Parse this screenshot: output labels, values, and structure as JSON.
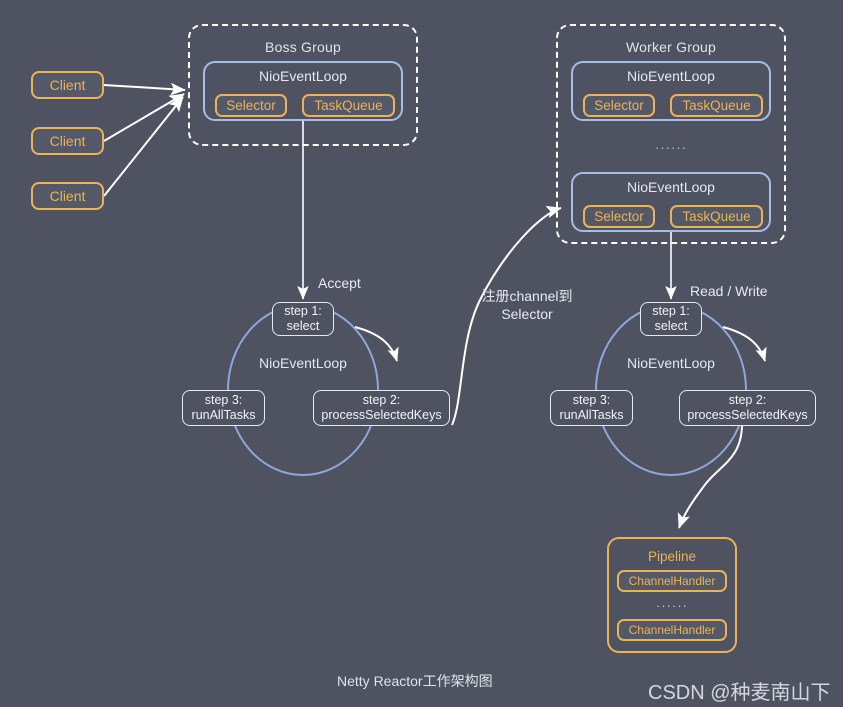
{
  "diagram": {
    "caption": "Netty Reactor工作架构图",
    "watermark": "CSDN @种麦南山下",
    "background_color": "#4e5261",
    "accent_orange": "#e9b458",
    "accent_blue": "#a9bde4",
    "circle_blue": "#8fa8d8",
    "line_white": "#ffffff"
  },
  "clients": [
    {
      "label": "Client"
    },
    {
      "label": "Client"
    },
    {
      "label": "Client"
    }
  ],
  "boss_group": {
    "title": "Boss Group",
    "event_loops": [
      {
        "title": "NioEventLoop",
        "components": [
          "Selector",
          "TaskQueue"
        ]
      }
    ]
  },
  "worker_group": {
    "title": "Worker Group",
    "ellipsis": "······",
    "event_loops": [
      {
        "title": "NioEventLoop",
        "components": [
          "Selector",
          "TaskQueue"
        ]
      },
      {
        "title": "NioEventLoop",
        "components": [
          "Selector",
          "TaskQueue"
        ]
      }
    ]
  },
  "boss_loop": {
    "center_label": "NioEventLoop",
    "incoming_label": "Accept",
    "steps": [
      {
        "line1": "step 1:",
        "line2": "select"
      },
      {
        "line1": "step 2:",
        "line2": "processSelectedKeys"
      },
      {
        "line1": "step 3:",
        "line2": "runAllTasks"
      }
    ]
  },
  "worker_loop": {
    "center_label": "NioEventLoop",
    "incoming_label": "Read / Write",
    "steps": [
      {
        "line1": "step 1:",
        "line2": "select"
      },
      {
        "line1": "step 2:",
        "line2": "processSelectedKeys"
      },
      {
        "line1": "step 3:",
        "line2": "runAllTasks"
      }
    ]
  },
  "register_edge": {
    "line1": "注册channel到",
    "line2": "Selector"
  },
  "pipeline": {
    "title": "Pipeline",
    "ellipsis": "······",
    "handlers": [
      {
        "label": "ChannelHandler"
      },
      {
        "label": "ChannelHandler"
      }
    ]
  }
}
